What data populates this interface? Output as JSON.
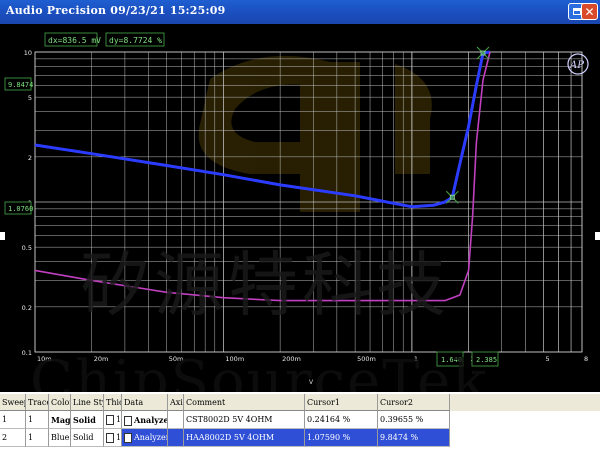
{
  "window": {
    "title": "Audio Precision   09/23/21  15:25:09",
    "maximize_icon": "maximize-icon",
    "close_icon": "close-icon",
    "close_symbol": "✕"
  },
  "readouts": {
    "dx": "dx=836.5   mV",
    "dy": "dy=8.7724   %",
    "y_cursor_upper": "9.8474",
    "y_cursor_lower": "1.0760",
    "x_cursor_1": "1.640",
    "x_cursor_2": "2.385"
  },
  "logo": "AP",
  "watermark": {
    "chinese": "矽源特科技",
    "latin": "ChipSourceTek"
  },
  "chart_data": {
    "type": "line",
    "xlabel": "V",
    "ylabel": "",
    "xscale": "log",
    "yscale": "log",
    "xlim": [
      0.01,
      8
    ],
    "ylim": [
      0.1,
      10
    ],
    "grid": true,
    "background": "#000000",
    "x_ticks": [
      "10m",
      "20m",
      "50m",
      "100m",
      "200m",
      "500m",
      "1",
      "2",
      "5",
      "8"
    ],
    "y_ticks": [
      "10",
      "5",
      "2",
      "1",
      "0.5",
      "0.2",
      "0.1"
    ],
    "series": [
      {
        "color": "#2b3cff",
        "x": [
          0.01,
          0.02,
          0.05,
          0.1,
          0.2,
          0.5,
          0.8,
          1.0,
          1.3,
          1.5,
          1.64,
          1.8,
          2.0,
          2.2,
          2.385,
          2.6
        ],
        "y": [
          2.4,
          2.1,
          1.75,
          1.52,
          1.3,
          1.1,
          0.98,
          0.93,
          0.95,
          1.0,
          1.076,
          1.8,
          3.2,
          6.0,
          9.8474,
          13
        ]
      },
      {
        "color": "#c040c0",
        "x": [
          0.01,
          0.02,
          0.05,
          0.1,
          0.2,
          0.5,
          1.0,
          1.5,
          1.8,
          2.0,
          2.1,
          2.2,
          2.385,
          2.6
        ],
        "y": [
          0.35,
          0.3,
          0.25,
          0.23,
          0.22,
          0.22,
          0.22,
          0.22,
          0.24,
          0.35,
          0.8,
          2.5,
          6.5,
          12
        ]
      }
    ],
    "cursors": [
      {
        "x": 1.64,
        "y": 1.076,
        "color": "#44aa44"
      },
      {
        "x": 2.385,
        "y": 9.8474,
        "color": "#44aa44"
      }
    ]
  },
  "table": {
    "columns": [
      "Sweep",
      "Trace",
      "Color",
      "Line Style",
      "Thick",
      "Data",
      "Axis",
      "Comment",
      "Cursor1",
      "Cursor2"
    ],
    "rows": [
      {
        "sweep": "1",
        "trace": "1",
        "color": "Mage",
        "line_style": "Solid",
        "thick": "1",
        "data": "Analyzer.THD+N Left",
        "axis": "",
        "comment": "CST8002D 5V 4OHM",
        "cursor1": "0.24164  %",
        "cursor2": "0.39655  %"
      },
      {
        "sweep": "2",
        "trace": "1",
        "color": "Blue",
        "line_style": "Solid",
        "thick": "1",
        "data": "Analyzer.THD+N Left",
        "axis": "",
        "comment": "HAA8002D 5V 4OHM",
        "cursor1": "1.07590  %",
        "cursor2": "9.8474  %"
      }
    ]
  }
}
